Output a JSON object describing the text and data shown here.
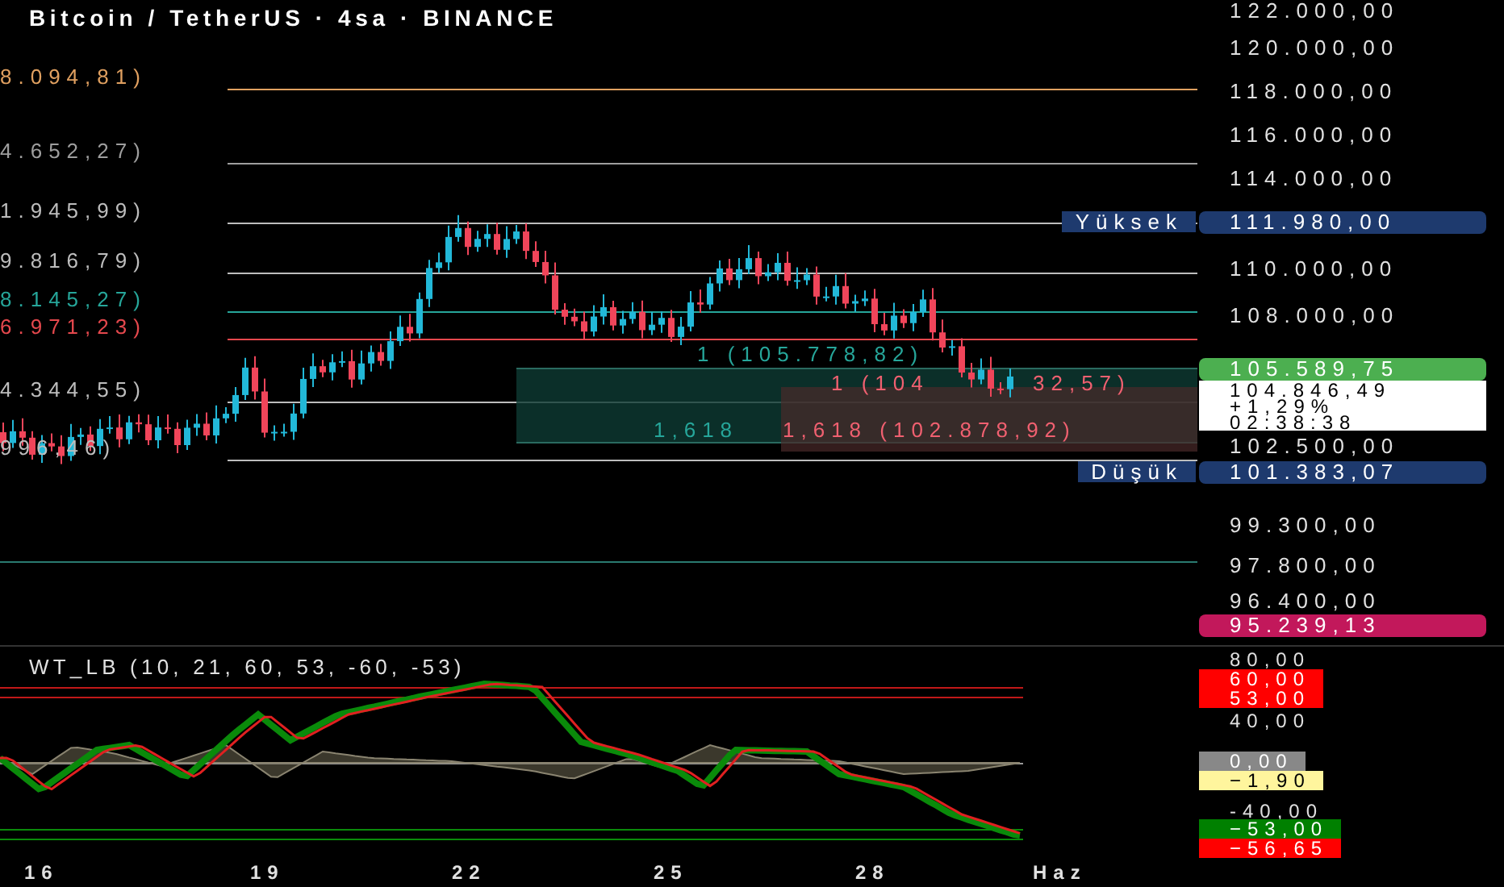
{
  "header": {
    "title": "Bitcoin / TetherUS · 4sa · BINANCE"
  },
  "fib_levels": [
    {
      "label": "8.094,81)",
      "color": "#e0a060"
    },
    {
      "label": "4.652,27)",
      "color": "#9e9e9e"
    },
    {
      "label": "1.945,99)",
      "color": "#bdbdbd"
    },
    {
      "label": "9.816,79)",
      "color": "#bdbdbd"
    },
    {
      "label": "8.145,27)",
      "color": "#26a69a"
    },
    {
      "label": "6.971,23)",
      "color": "#e5484d"
    },
    {
      "label": "4.344,55)",
      "color": "#bdbdbd"
    },
    {
      "label": "996,46)",
      "color": "#bdbdbd"
    }
  ],
  "zone_labels": [
    {
      "text": "1 (105.778,82)",
      "color": "#26a69a"
    },
    {
      "text": "1 (104",
      "color": "#f06070"
    },
    {
      "text": "32,57)",
      "color": "#f06070"
    },
    {
      "text": "1,618",
      "color": "#26a69a"
    },
    {
      "text": "1,618 (102.878,92)",
      "color": "#f06070"
    }
  ],
  "price_axis": {
    "ticks": [
      "122.000,00",
      "120.000,00",
      "118.000,00",
      "116.000,00",
      "114.000,00",
      "110.000,00",
      "108.000,00",
      "102.500,00",
      "99.300,00",
      "97.800,00",
      "96.400,00"
    ],
    "badges": [
      {
        "kind": "high",
        "label": "Yüksek",
        "value": "111.980,00",
        "color": "#1e3a6e"
      },
      {
        "kind": "price",
        "value": "105.589,75",
        "color": "#4caf50"
      },
      {
        "kind": "low",
        "label": "Düşük",
        "value": "101.383,07",
        "color": "#1e3a6e"
      },
      {
        "kind": "price",
        "value": "95.239,13",
        "color": "#c2185b"
      }
    ],
    "current": {
      "price": "104.846,49",
      "change": "+1,29%",
      "countdown": "02:38:38"
    }
  },
  "indicator": {
    "title": "WT_LB (10, 21, 60, 53, -60, -53)",
    "ticks": [
      "80,00",
      "40,00",
      "-40,00"
    ],
    "badges": [
      {
        "value": "60,00",
        "color": "#ff0000"
      },
      {
        "value": "53,00",
        "color": "#ff0000"
      },
      {
        "value": "0,00",
        "color": "#888888"
      },
      {
        "value": "−1,90",
        "color": "#fff59d"
      },
      {
        "value": "−53,00",
        "color": "#008000"
      },
      {
        "value": "−56,65",
        "color": "#ff0000"
      }
    ]
  },
  "time_axis": [
    "16",
    "19",
    "22",
    "25",
    "28",
    "Haz"
  ]
}
